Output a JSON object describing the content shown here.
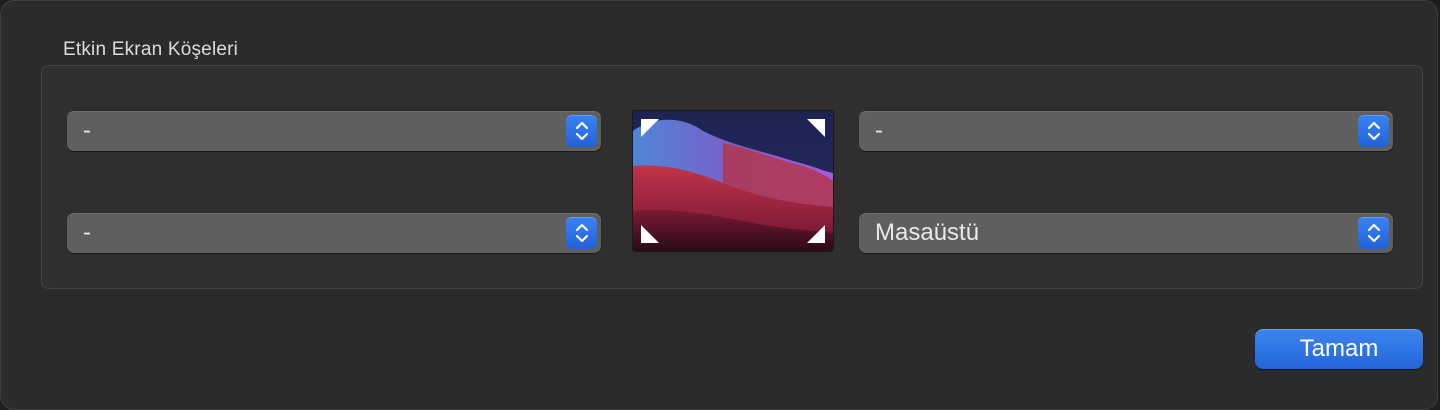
{
  "dialog": {
    "section_title": "Etkin Ekran Köşeleri",
    "corners": {
      "top_left": "-",
      "bottom_left": "-",
      "top_right": "-",
      "bottom_right": "Masaüstü"
    },
    "ok_label": "Tamam"
  },
  "colors": {
    "accent": "#2f74e8",
    "popup_bg": "#5f5f5f",
    "dialog_bg": "#2b2b2b",
    "group_bg": "#2f2f2f"
  },
  "icons": {
    "popup_stepper": "chevron-up-down-icon",
    "corner_marker": "corner-triangle-icon"
  }
}
